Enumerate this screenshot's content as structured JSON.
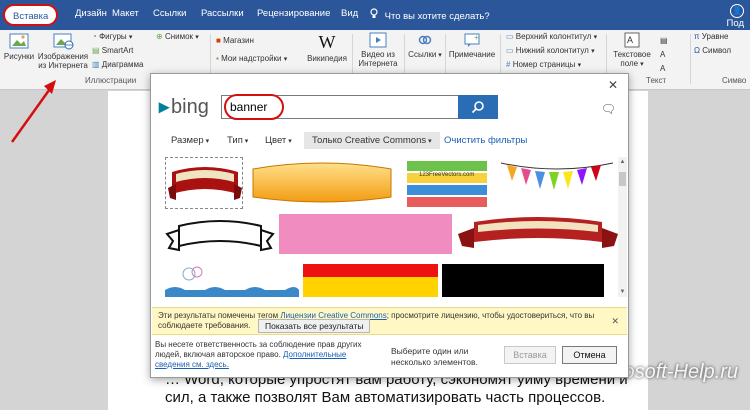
{
  "ribbon": {
    "tabs": [
      {
        "label": "Вставка",
        "active": true
      },
      {
        "label": "Дизайн"
      },
      {
        "label": "Макет"
      },
      {
        "label": "Ссылки"
      },
      {
        "label": "Рассылки"
      },
      {
        "label": "Рецензирование"
      },
      {
        "label": "Вид"
      }
    ],
    "tell_me": "Что вы хотите сделать?",
    "share": "Под",
    "commands": {
      "pictures": "Рисунки",
      "online_pictures_1": "Изображения",
      "online_pictures_2": "из Интернета",
      "shapes": "Фигуры",
      "smartart": "SmartArt",
      "chart": "Диаграмма",
      "screenshot": "Снимок",
      "store": "Магазин",
      "my_addins": "Мои надстройки",
      "wikipedia": "Википедия",
      "video_1": "Видео из",
      "video_2": "Интернета",
      "links": "Ссылки",
      "comment": "Примечание",
      "header": "Верхний колонтитул",
      "footer": "Нижний колонтитул",
      "page_number": "Номер страницы",
      "textbox_1": "Текстовое",
      "textbox_2": "поле",
      "equation": "Уравне",
      "symbol": "Символ"
    },
    "groups": {
      "illustrations": "Иллюстрации",
      "text": "Текст",
      "symbols": "Симво"
    }
  },
  "dialog": {
    "search_value": "banner",
    "bing_label": "bing",
    "filters": {
      "size": "Размер",
      "type": "Тип",
      "color": "Цвет",
      "cc": "Только Creative Commons",
      "clear": "Очистить фильтры"
    },
    "thumbnail_label": "123FreeVectors.com",
    "notice": {
      "text_before": "Эти результаты помечены тегом ",
      "link": "Лицензии Creative Commons",
      "text_after": "; просмотрите лицензию, чтобы удостовериться, что вы соблюдаете требования.",
      "button": "Показать все результаты"
    },
    "footer": {
      "text": "Вы несете ответственность за соблюдение прав других людей, включая авторское право.",
      "link": "Дополнительные сведения см. здесь.",
      "hint": "Выберите один или несколько элементов.",
      "insert": "Вставка",
      "cancel": "Отмена"
    }
  },
  "document": {
    "line1": "… Word, которые упростят вам работу, сэкономят уйму времени и",
    "line2": "сил, а также позволят Вам автоматизировать часть процессов."
  },
  "watermark": "Microsoft-Help.ru",
  "colors": {
    "ribbon_blue": "#2b579a",
    "highlight_red": "#d40f0f",
    "bing_teal": "#00809d",
    "search_button": "#2b6db5",
    "notice_yellow": "#fff8c4"
  }
}
